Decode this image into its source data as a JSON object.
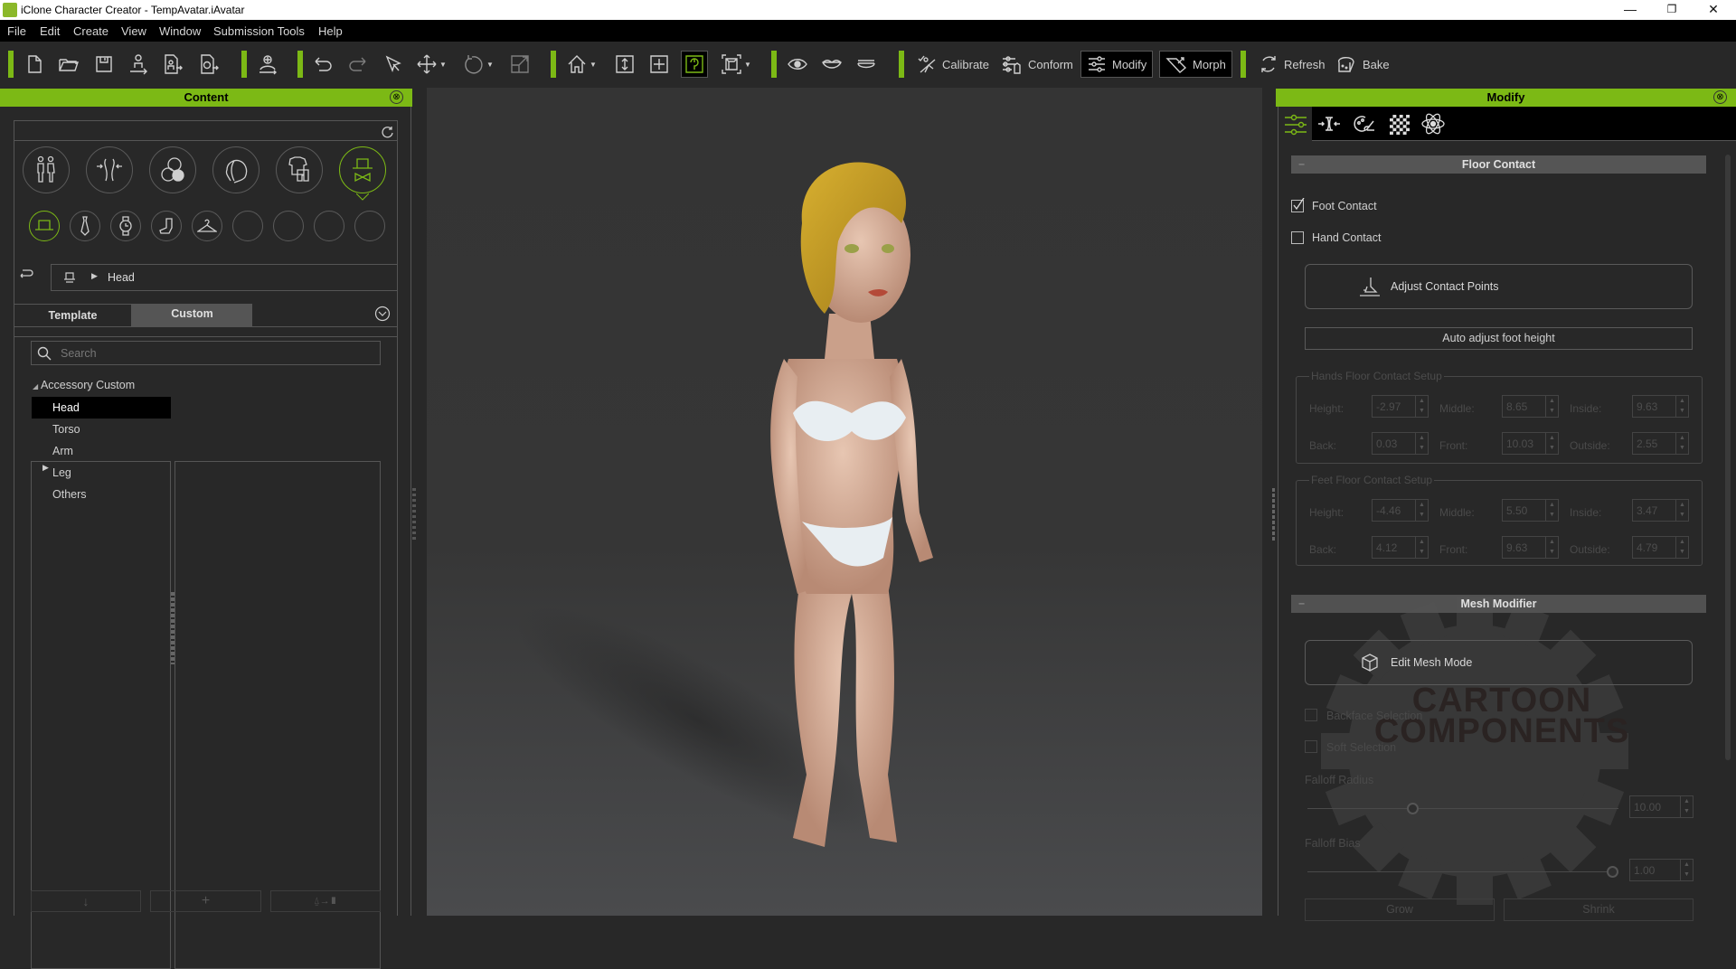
{
  "window": {
    "title": "iClone Character Creator - TempAvatar.iAvatar",
    "minimize": "—",
    "maximize": "❐",
    "close": "✕"
  },
  "menu": [
    "File",
    "Edit",
    "Create",
    "View",
    "Window",
    "Submission Tools",
    "Help"
  ],
  "toolbar": {
    "calibrate": "Calibrate",
    "conform": "Conform",
    "modify": "Modify",
    "morph": "Morph",
    "refresh": "Refresh",
    "bake": "Bake",
    "accent_color": "#7cb915"
  },
  "content_panel": {
    "title": "Content",
    "close": "⊗",
    "breadcrumb": "Head",
    "tabs": [
      {
        "label": "Template",
        "active": false
      },
      {
        "label": "Custom",
        "active": true
      }
    ],
    "search_placeholder": "Search",
    "tree": {
      "root": "Accessory Custom",
      "items": [
        {
          "label": "Head",
          "selected": true
        },
        {
          "label": "Torso",
          "selected": false
        },
        {
          "label": "Arm",
          "selected": false
        },
        {
          "label": "Leg",
          "selected": false,
          "expandable": true
        },
        {
          "label": "Others",
          "selected": false
        }
      ]
    },
    "category_icons": [
      "character-type-icon",
      "body-morph-icon",
      "skin-material-icon",
      "head-icon",
      "clothing-icon",
      "accessory-icon"
    ],
    "sub_category_icons": [
      "hat-icon",
      "tie-icon",
      "watch-icon",
      "sock-icon",
      "hanger-icon",
      "empty",
      "empty",
      "empty",
      "empty"
    ]
  },
  "modify_panel": {
    "title": "Modify",
    "close": "⊗",
    "floor_contact": {
      "title": "Floor Contact",
      "foot_contact": {
        "label": "Foot Contact",
        "checked": true
      },
      "hand_contact": {
        "label": "Hand Contact",
        "checked": false
      },
      "adjust_contact_points": "Adjust Contact Points",
      "auto_adjust": "Auto adjust foot height",
      "hands_setup": {
        "title": "Hands Floor Contact Setup",
        "height_label": "Height:",
        "height": "-2.97",
        "middle_label": "Middle:",
        "middle": "8.65",
        "inside_label": "Inside:",
        "inside": "9.63",
        "back_label": "Back:",
        "back": "0.03",
        "front_label": "Front:",
        "front": "10.03",
        "outside_label": "Outside:",
        "outside": "2.55"
      },
      "feet_setup": {
        "title": "Feet Floor Contact Setup",
        "height_label": "Height:",
        "height": "-4.46",
        "middle_label": "Middle:",
        "middle": "5.50",
        "inside_label": "Inside:",
        "inside": "3.47",
        "back_label": "Back:",
        "back": "4.12",
        "front_label": "Front:",
        "front": "9.63",
        "outside_label": "Outside:",
        "outside": "4.79"
      }
    },
    "mesh_modifier": {
      "title": "Mesh Modifier",
      "edit_mesh_mode": "Edit Mesh Mode",
      "backface_selection": {
        "label": "Backface Selection",
        "checked": false
      },
      "soft_selection": {
        "label": "Soft Selection",
        "checked": false
      },
      "falloff_radius": {
        "label": "Falloff Radius",
        "value": "10.00",
        "fraction": 0.34
      },
      "falloff_bias": {
        "label": "Falloff Bias",
        "value": "1.00",
        "fraction": 1.0
      },
      "grow": "Grow",
      "shrink": "Shrink"
    },
    "watermark": {
      "line1": "CARTOON",
      "line2": "COMPONENTS"
    }
  }
}
